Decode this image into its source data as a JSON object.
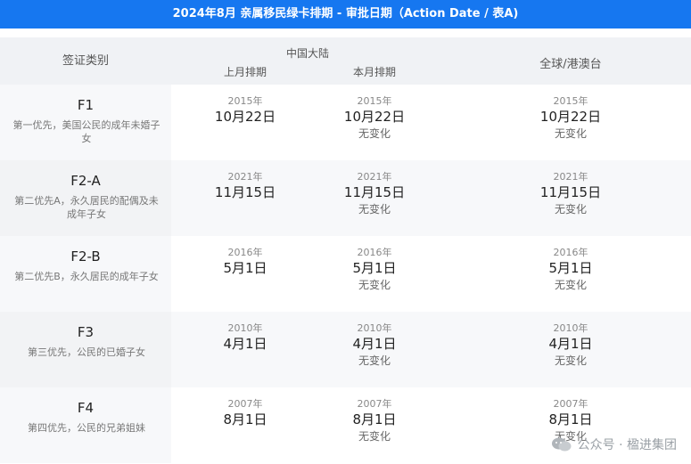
{
  "title": "2024年8月 亲属移民绿卡排期 - 审批日期（Action Date / 表A)",
  "headers": {
    "category": "签证类别",
    "china": "中国大陆",
    "last_month": "上月排期",
    "this_month": "本月排期",
    "global": "全球/港澳台"
  },
  "rows": [
    {
      "code": "F1",
      "desc": "第一优先，美国公民的成年未婚子女",
      "last_year": "2015年",
      "last_md": "10月22日",
      "cur_year": "2015年",
      "cur_md": "10月22日",
      "cur_change": "无变化",
      "g_year": "2015年",
      "g_md": "10月22日",
      "g_change": "无变化"
    },
    {
      "code": "F2-A",
      "desc": "第二优先A，永久居民的配偶及未成年子女",
      "last_year": "2021年",
      "last_md": "11月15日",
      "cur_year": "2021年",
      "cur_md": "11月15日",
      "cur_change": "无变化",
      "g_year": "2021年",
      "g_md": "11月15日",
      "g_change": "无变化"
    },
    {
      "code": "F2-B",
      "desc": "第二优先B，永久居民的成年子女",
      "last_year": "2016年",
      "last_md": "5月1日",
      "cur_year": "2016年",
      "cur_md": "5月1日",
      "cur_change": "无变化",
      "g_year": "2016年",
      "g_md": "5月1日",
      "g_change": "无变化"
    },
    {
      "code": "F3",
      "desc": "第三优先，公民的已婚子女",
      "last_year": "2010年",
      "last_md": "4月1日",
      "cur_year": "2010年",
      "cur_md": "4月1日",
      "cur_change": "无变化",
      "g_year": "2010年",
      "g_md": "4月1日",
      "g_change": "无变化"
    },
    {
      "code": "F4",
      "desc": "第四优先，公民的兄弟姐妹",
      "last_year": "2007年",
      "last_md": "8月1日",
      "cur_year": "2007年",
      "cur_md": "8月1日",
      "cur_change": "无变化",
      "g_year": "2007年",
      "g_md": "8月1日",
      "g_change": "无变化"
    }
  ],
  "watermark": "公众号 · 楹进集团",
  "colors": {
    "banner": "#1677f0",
    "header_bg": "#f0f2f5"
  }
}
